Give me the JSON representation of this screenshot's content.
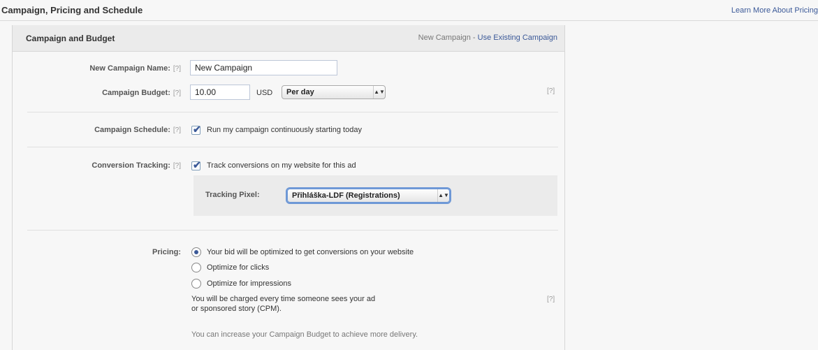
{
  "header": {
    "title": "Campaign, Pricing and Schedule",
    "learn_more": "Learn More About Pricing"
  },
  "panel": {
    "title": "Campaign and Budget",
    "new_campaign_text": "New Campaign - ",
    "use_existing_link": "Use Existing Campaign"
  },
  "help_marker": "[?]",
  "fields": {
    "campaign_name": {
      "label": "New Campaign Name:",
      "value": "New Campaign"
    },
    "campaign_budget": {
      "label": "Campaign Budget:",
      "value": "10.00",
      "currency": "USD",
      "period": "Per day"
    },
    "schedule": {
      "label": "Campaign Schedule:",
      "checkbox_label": "Run my campaign continuously starting today",
      "checked": true
    },
    "conversion": {
      "label": "Conversion Tracking:",
      "checkbox_label": "Track conversions on my website for this ad",
      "checked": true
    },
    "tracking_pixel": {
      "label": "Tracking Pixel:",
      "value": "Přihláška-LDF (Registrations)"
    },
    "pricing": {
      "label": "Pricing:",
      "options": [
        {
          "label": "Your bid will be optimized to get conversions on your website",
          "selected": true
        },
        {
          "label": "Optimize for clicks",
          "selected": false
        },
        {
          "label": "Optimize for impressions",
          "selected": false
        }
      ],
      "note_line1": "You will be charged every time someone sees your ad",
      "note_line2": "or sponsored story (CPM).",
      "budget_note": "You can increase your Campaign Budget to achieve more delivery."
    }
  },
  "colors": {
    "link": "#3b5998",
    "accent": "#6e98d6"
  }
}
